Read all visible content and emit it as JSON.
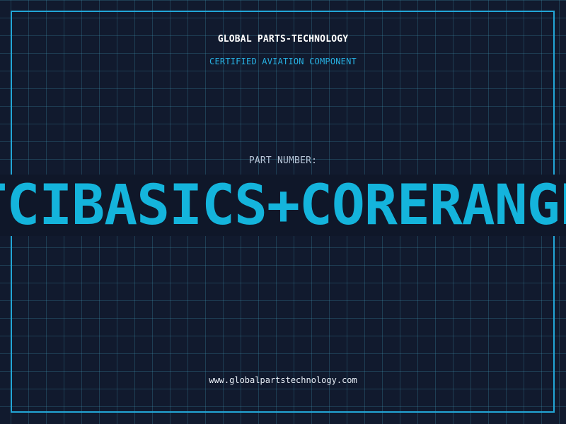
{
  "header": {
    "brand": "GLOBAL PARTS-TECHNOLOGY",
    "subtitle": "CERTIFIED AVIATION COMPONENT"
  },
  "part": {
    "label": "PART NUMBER:",
    "value": "TCIBASICS+CORERANGE"
  },
  "footer": {
    "url": "www.globalpartstechnology.com"
  },
  "colors": {
    "background": "#111a2e",
    "grid": "#2a6b86",
    "frame": "#22a6d6",
    "accent": "#14b4dc"
  }
}
